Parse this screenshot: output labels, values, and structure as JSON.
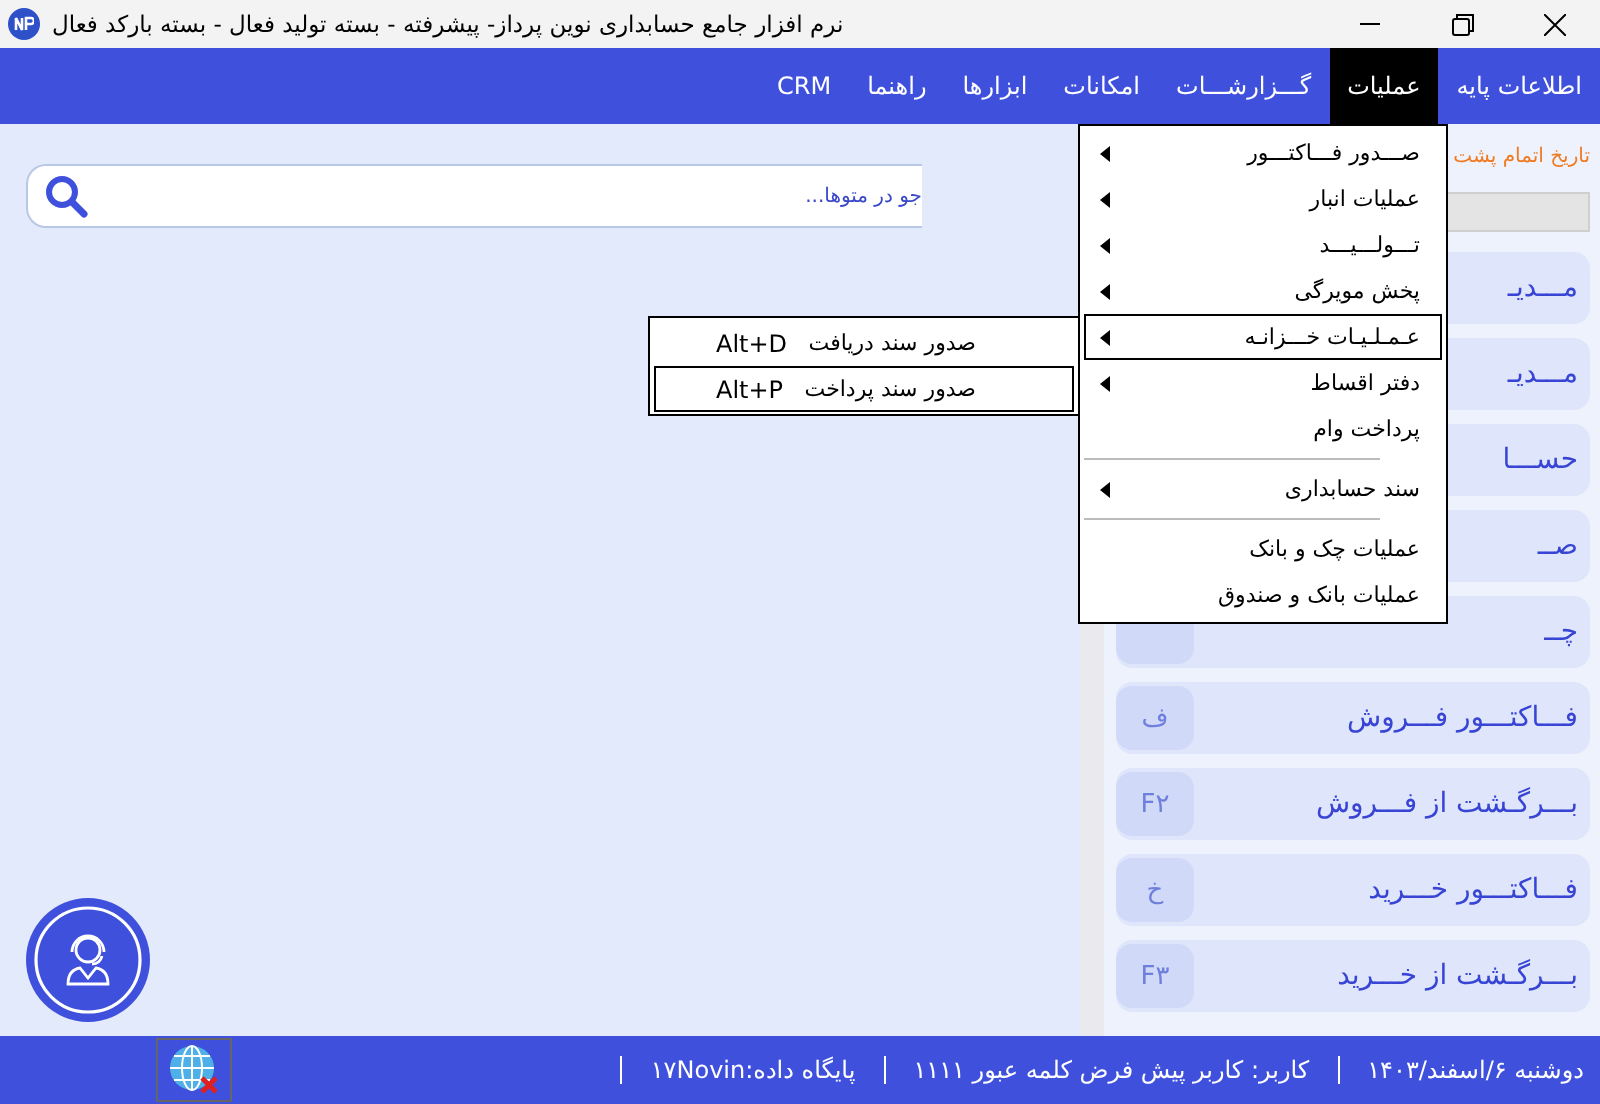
{
  "window": {
    "title": "نرم افزار جامع حسابداری نوین پرداز- پیشرفته - بسته تولید فعال - بسته بارکد فعال"
  },
  "menu_bar": [
    {
      "label": "اطلاعات پایه",
      "selected": false
    },
    {
      "label": "عملیات",
      "selected": true
    },
    {
      "label": "گـــزارشـــات",
      "selected": false
    },
    {
      "label": "امکانات",
      "selected": false
    },
    {
      "label": "ابزارها",
      "selected": false
    },
    {
      "label": "راهنما",
      "selected": false
    },
    {
      "label": "CRM",
      "selected": false
    }
  ],
  "dropdown": [
    {
      "kind": "item",
      "label": "صـــدور فـــاکتـــور",
      "submenu": true,
      "selected": false
    },
    {
      "kind": "item",
      "label": "عملیات انبار",
      "submenu": true,
      "selected": false
    },
    {
      "kind": "item",
      "label": "تـــولـــیـــد",
      "submenu": true,
      "selected": false
    },
    {
      "kind": "item",
      "label": "پخش مویرگی",
      "submenu": true,
      "selected": false
    },
    {
      "kind": "item",
      "label": "عـمـلـیـات خـــزانـه",
      "submenu": true,
      "selected": true
    },
    {
      "kind": "item",
      "label": "دفتر اقساط",
      "submenu": true,
      "selected": false
    },
    {
      "kind": "item",
      "label": "پرداخت وام",
      "submenu": false,
      "selected": false
    },
    {
      "kind": "separator"
    },
    {
      "kind": "item",
      "label": "سند حسابداری",
      "submenu": true,
      "selected": false
    },
    {
      "kind": "separator"
    },
    {
      "kind": "item",
      "label": "عملیات چک و بانک",
      "submenu": false,
      "selected": false
    },
    {
      "kind": "item",
      "label": "عملیات بانک و صندوق",
      "submenu": false,
      "selected": false
    }
  ],
  "submenu": [
    {
      "label": "صدور سند دریافت",
      "shortcut": "Alt+D",
      "selected": false
    },
    {
      "label": "صدور سند پرداخت",
      "shortcut": "Alt+P",
      "selected": true
    }
  ],
  "search": {
    "placeholder": "جو در متوها..."
  },
  "side_panel": {
    "notice": "تاریخ اتمام پشت",
    "shortcuts": [
      {
        "label": "مـــدیـ"
      },
      {
        "label": "مـــدیـ"
      },
      {
        "label": "حســـا"
      },
      {
        "label": "صــ"
      },
      {
        "label": "چــ",
        "badge": true
      },
      {
        "label": "فـــاکتـــور فـــروش",
        "key": "ف"
      },
      {
        "label": "بـــرگـشت از فـــروش",
        "key": "F۲"
      },
      {
        "label": "فـــاکتـــور خـــرید",
        "key": "خ"
      },
      {
        "label": "بـــرگـشت از خـــرید",
        "key": "F۳"
      }
    ]
  },
  "status_bar": [
    "دوشنبه ۶/اسفند/۱۴۰۳",
    "کاربر: کاربر پیش فرض کلمه عبور ۱۱۱۱",
    "پایگاه داده:۱۷Novin"
  ]
}
